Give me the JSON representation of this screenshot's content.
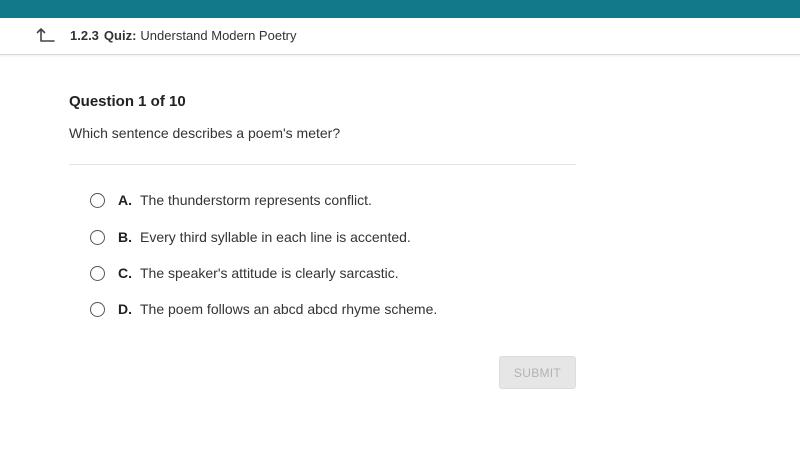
{
  "header": {
    "lesson_number": "1.2.3",
    "kind": "Quiz:",
    "title": "Understand Modern Poetry",
    "back_icon": "back-arrow-icon"
  },
  "question": {
    "number_label": "Question 1 of 10",
    "text": "Which sentence describes a poem's meter?"
  },
  "options": [
    {
      "letter": "A.",
      "text": "The thunderstorm represents conflict."
    },
    {
      "letter": "B.",
      "text": "Every third syllable in each line is accented."
    },
    {
      "letter": "C.",
      "text": "The speaker's attitude is clearly sarcastic."
    },
    {
      "letter": "D.",
      "text": "The poem follows an abcd abcd rhyme scheme."
    }
  ],
  "submit": {
    "label": "SUBMIT",
    "enabled": false
  },
  "colors": {
    "accent": "#12798a"
  }
}
